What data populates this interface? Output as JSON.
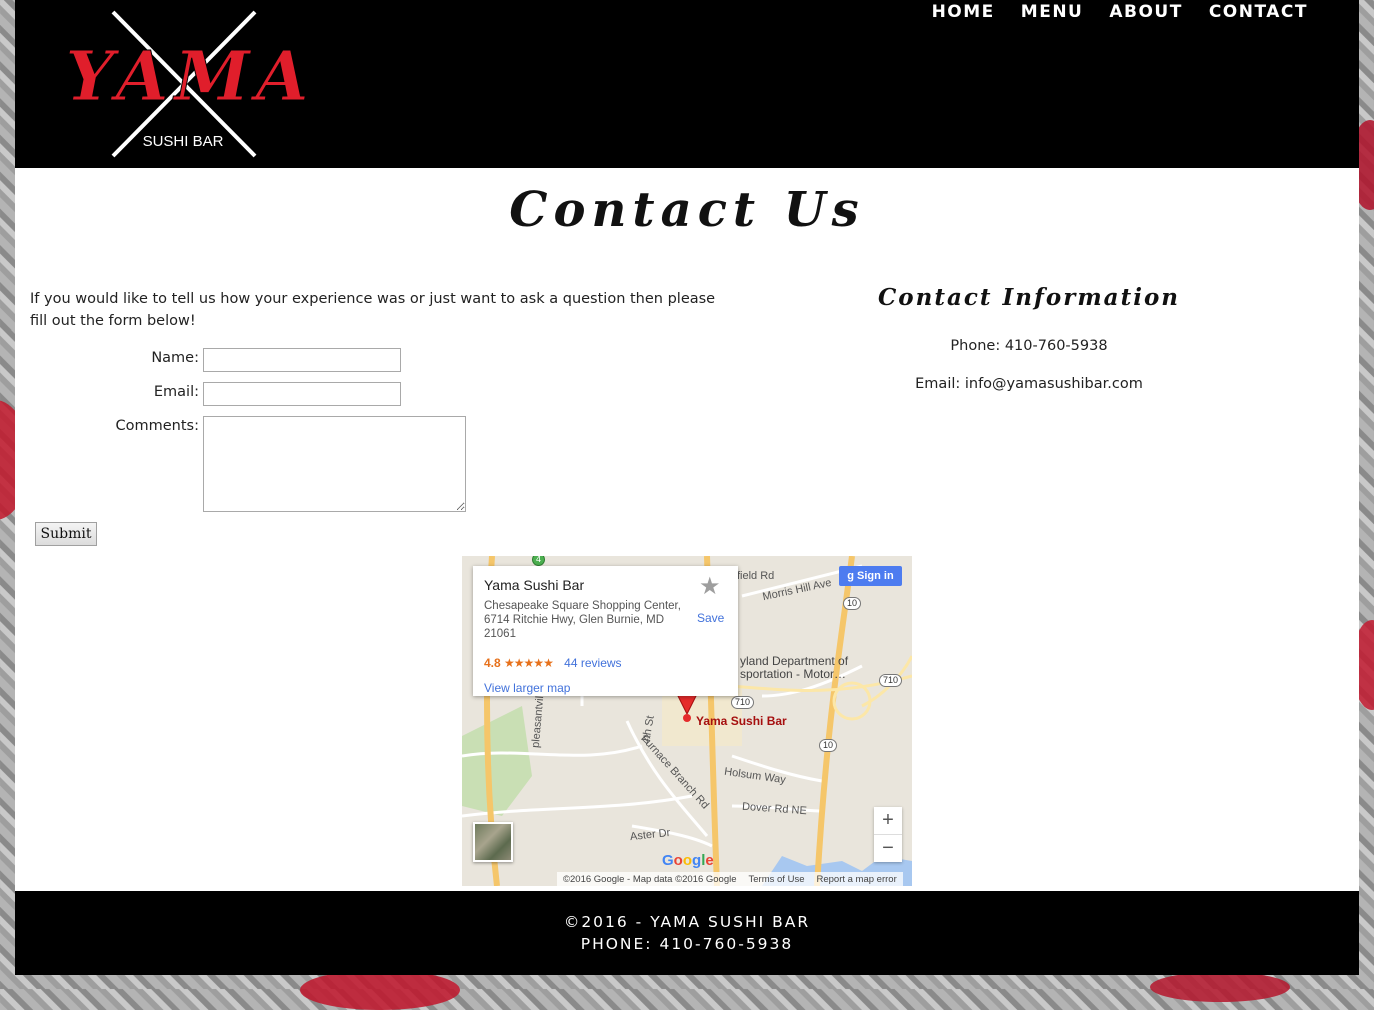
{
  "brand": {
    "logo_text": "YAMA",
    "logo_subtitle": "SUSHI BAR",
    "accent_color": "#e01e2b"
  },
  "nav": {
    "items": [
      {
        "label": "HOME"
      },
      {
        "label": "MENU"
      },
      {
        "label": "ABOUT"
      },
      {
        "label": "CONTACT"
      }
    ]
  },
  "main": {
    "title": "Contact Us",
    "intro": "If you would like to tell us how your experience was or just want to ask a question then please fill out the form below!",
    "form": {
      "name_label": "Name:",
      "name_value": "",
      "email_label": "Email:",
      "email_value": "",
      "comments_label": "Comments:",
      "comments_value": "",
      "submit_label": "Submit"
    }
  },
  "contact_info": {
    "title": "Contact Information",
    "phone": "Phone: 410-760-5938",
    "email": "Email: info@yamasushibar.com"
  },
  "map": {
    "place_name": "Yama Sushi Bar",
    "address": "Chesapeake Square Shopping Center, 6714 Ritchie Hwy, Glen Burnie, MD 21061",
    "rating": "4.8",
    "stars": "★★★★★",
    "reviews": "44 reviews",
    "view_larger": "View larger map",
    "save_label": "Save",
    "sign_in": "Sign in",
    "pin_label": "Yama Sushi Bar",
    "labels": {
      "morris_hill": "Morris Hill Ave",
      "field_rd": "field Rd",
      "md_dept": "yland Department of",
      "md_dept2": "sportation - Motor…",
      "holsum": "Holsum Way",
      "dover": "Dover Rd NE",
      "aster": "Aster Dr",
      "furnace": "Furnace Branch Rd",
      "fourth": "4th St",
      "pleasantville": "pleasantvil"
    },
    "shields": {
      "r10a": "10",
      "r10b": "10",
      "r710a": "710",
      "r710b": "710",
      "r4": "4"
    },
    "attribution": {
      "data": "©2016 Google - Map data ©2016 Google",
      "terms": "Terms of Use",
      "report": "Report a map error"
    },
    "google_logo": "Google"
  },
  "footer": {
    "line1": "©2016 - YAMA SUSHI BAR",
    "line2": "PHONE: 410-760-5938"
  }
}
